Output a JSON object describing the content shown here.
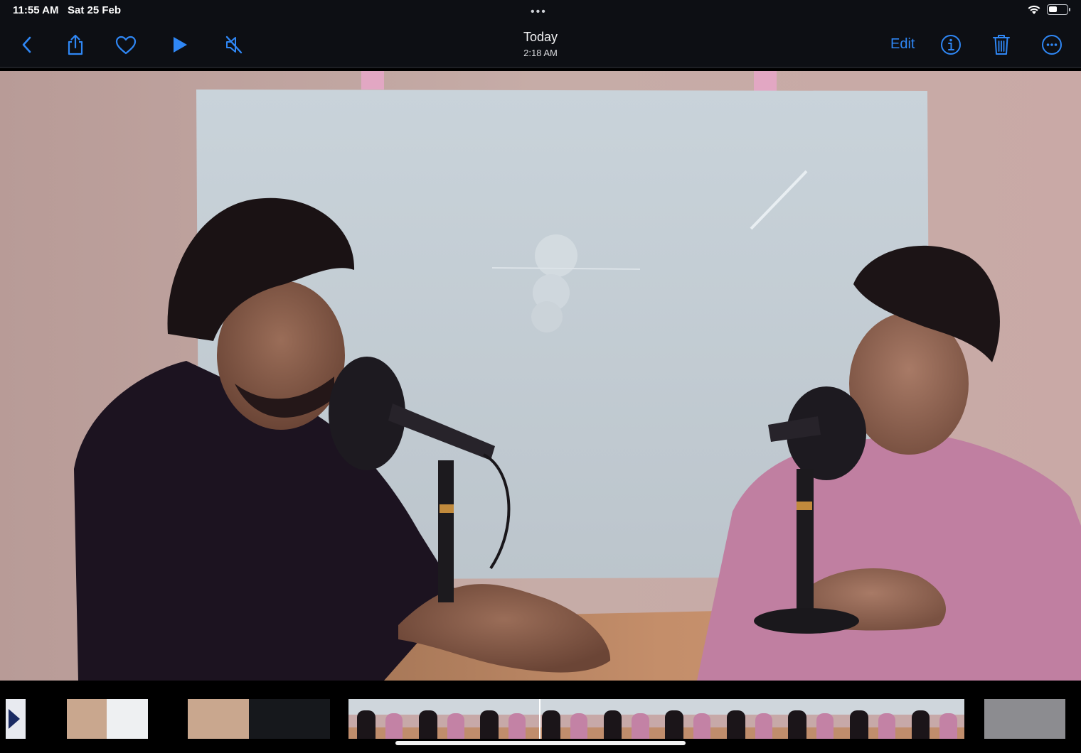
{
  "status": {
    "time": "11:55 AM",
    "date": "Sat 25 Feb",
    "dots": "•••",
    "wifi_icon": "wifi-icon",
    "battery_level": 0.45
  },
  "nav": {
    "title": "Today",
    "subtitle": "2:18 AM",
    "edit_label": "Edit",
    "accent": "#2f87f5",
    "icons": [
      "back-chevron-icon",
      "share-icon",
      "heart-icon",
      "play-icon",
      "mute-icon",
      "info-icon",
      "trash-icon",
      "more-icon"
    ]
  },
  "viewer": {
    "media_type": "video",
    "filmstrip_selected_index": 1
  }
}
